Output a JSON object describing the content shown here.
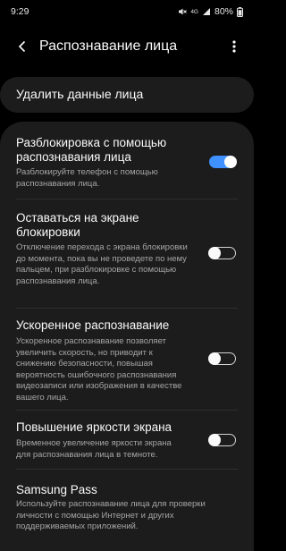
{
  "status_bar": {
    "time": "9:29",
    "icons": [
      "mute-icon",
      "lte-signal-icon",
      "signal-bars-icon",
      "battery-icon"
    ],
    "network_label": "4G",
    "battery_percent": "80%"
  },
  "app_bar": {
    "back_icon": "chevron-left-icon",
    "title": "Распознавание лица",
    "more_icon": "more-vertical-icon"
  },
  "delete_card": {
    "label": "Удалить данные лица"
  },
  "settings": [
    {
      "title": "Разблокировка с помощью распознавания лица",
      "description": "Разблокируйте телефон с помощью распознавания лица.",
      "enabled": true
    },
    {
      "title": "Оставаться на экране блокировки",
      "description": "Отключение перехода с экрана блокировки до момента, пока вы не проведете по нему пальцем, при разблокировке с помощью распознавания лица.",
      "enabled": false
    },
    {
      "title": "Ускоренное распознавание",
      "description": "Ускоренное распознавание позволяет увеличить скорость, но приводит к снижению безопасности, повышая вероятность ошибочного распознавания видеозаписи или изображения в качестве вашего лица.",
      "enabled": false
    },
    {
      "title": "Повышение яркости экрана",
      "description": "Временное увеличение яркости экрана для распознавания лица в темноте.",
      "enabled": false
    },
    {
      "title": "Samsung Pass",
      "description": "Используйте распознавание лица для проверки личности с помощью Интернет и других поддерживаемых приложений."
    }
  ],
  "colors": {
    "background": "#000000",
    "card": "#1c1c1c",
    "accent": "#3e91ff",
    "secondary_text": "#a6a6a6"
  }
}
